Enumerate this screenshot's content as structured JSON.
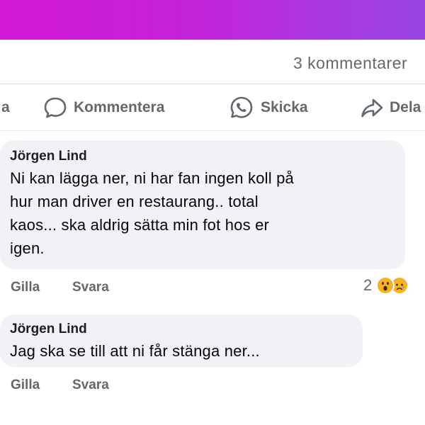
{
  "header": {
    "comment_count": "3 kommentarer"
  },
  "actions": {
    "left_fragment": "a",
    "comment_label": "Kommentera",
    "send_label": "Skicka",
    "share_label": "Dela"
  },
  "comments": [
    {
      "author": "Jörgen Lind",
      "text": "Ni kan lägga ner, ni har fan ingen koll på\nhur man driver en restaurang.. total\nkaos... ska aldrig sätta min fot hos er\nigen.",
      "like_label": "Gilla",
      "reply_label": "Svara",
      "reaction_count": "2",
      "reactions": [
        "wow-emoji",
        "sad-emoji"
      ]
    },
    {
      "author": "Jörgen Lind",
      "text": "Jag ska se till att ni får stänga ner...",
      "like_label": "Gilla",
      "reply_label": "Svara"
    }
  ],
  "colors": {
    "header_gradient_start": "#d21ad6",
    "header_gradient_end": "#9a45e4",
    "bubble": "#f0f2f5",
    "muted_text": "#65676b",
    "reaction_yellow": "#f7b125"
  }
}
